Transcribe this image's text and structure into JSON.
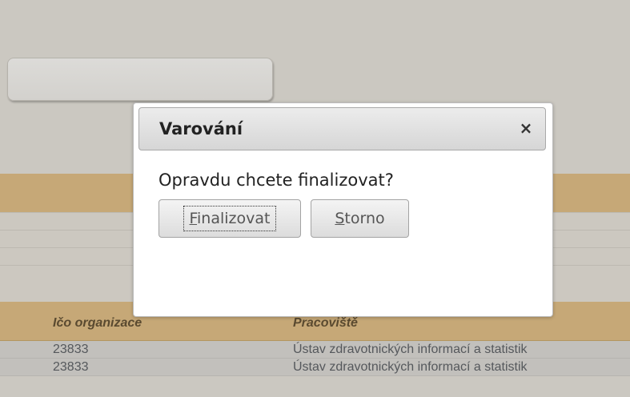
{
  "background": {
    "table": {
      "headers": [
        "Ičo organizace",
        "Pracoviště"
      ],
      "rows": [
        [
          "23833",
          "Ústav zdravotnických informací a statistik"
        ],
        [
          "23833",
          "Ústav zdravotnických informací a statistik"
        ]
      ]
    }
  },
  "dialog": {
    "title": "Varování",
    "close_glyph": "×",
    "message": "Opravdu chcete finalizovat?",
    "confirm_label": "Finalizovat",
    "cancel_label": "Storno"
  },
  "colors": {
    "overlay": "#cbc8c1",
    "table_header": "#c6a877",
    "dialog_bg": "#ffffff"
  },
  "icons": {
    "close": "close-icon"
  }
}
